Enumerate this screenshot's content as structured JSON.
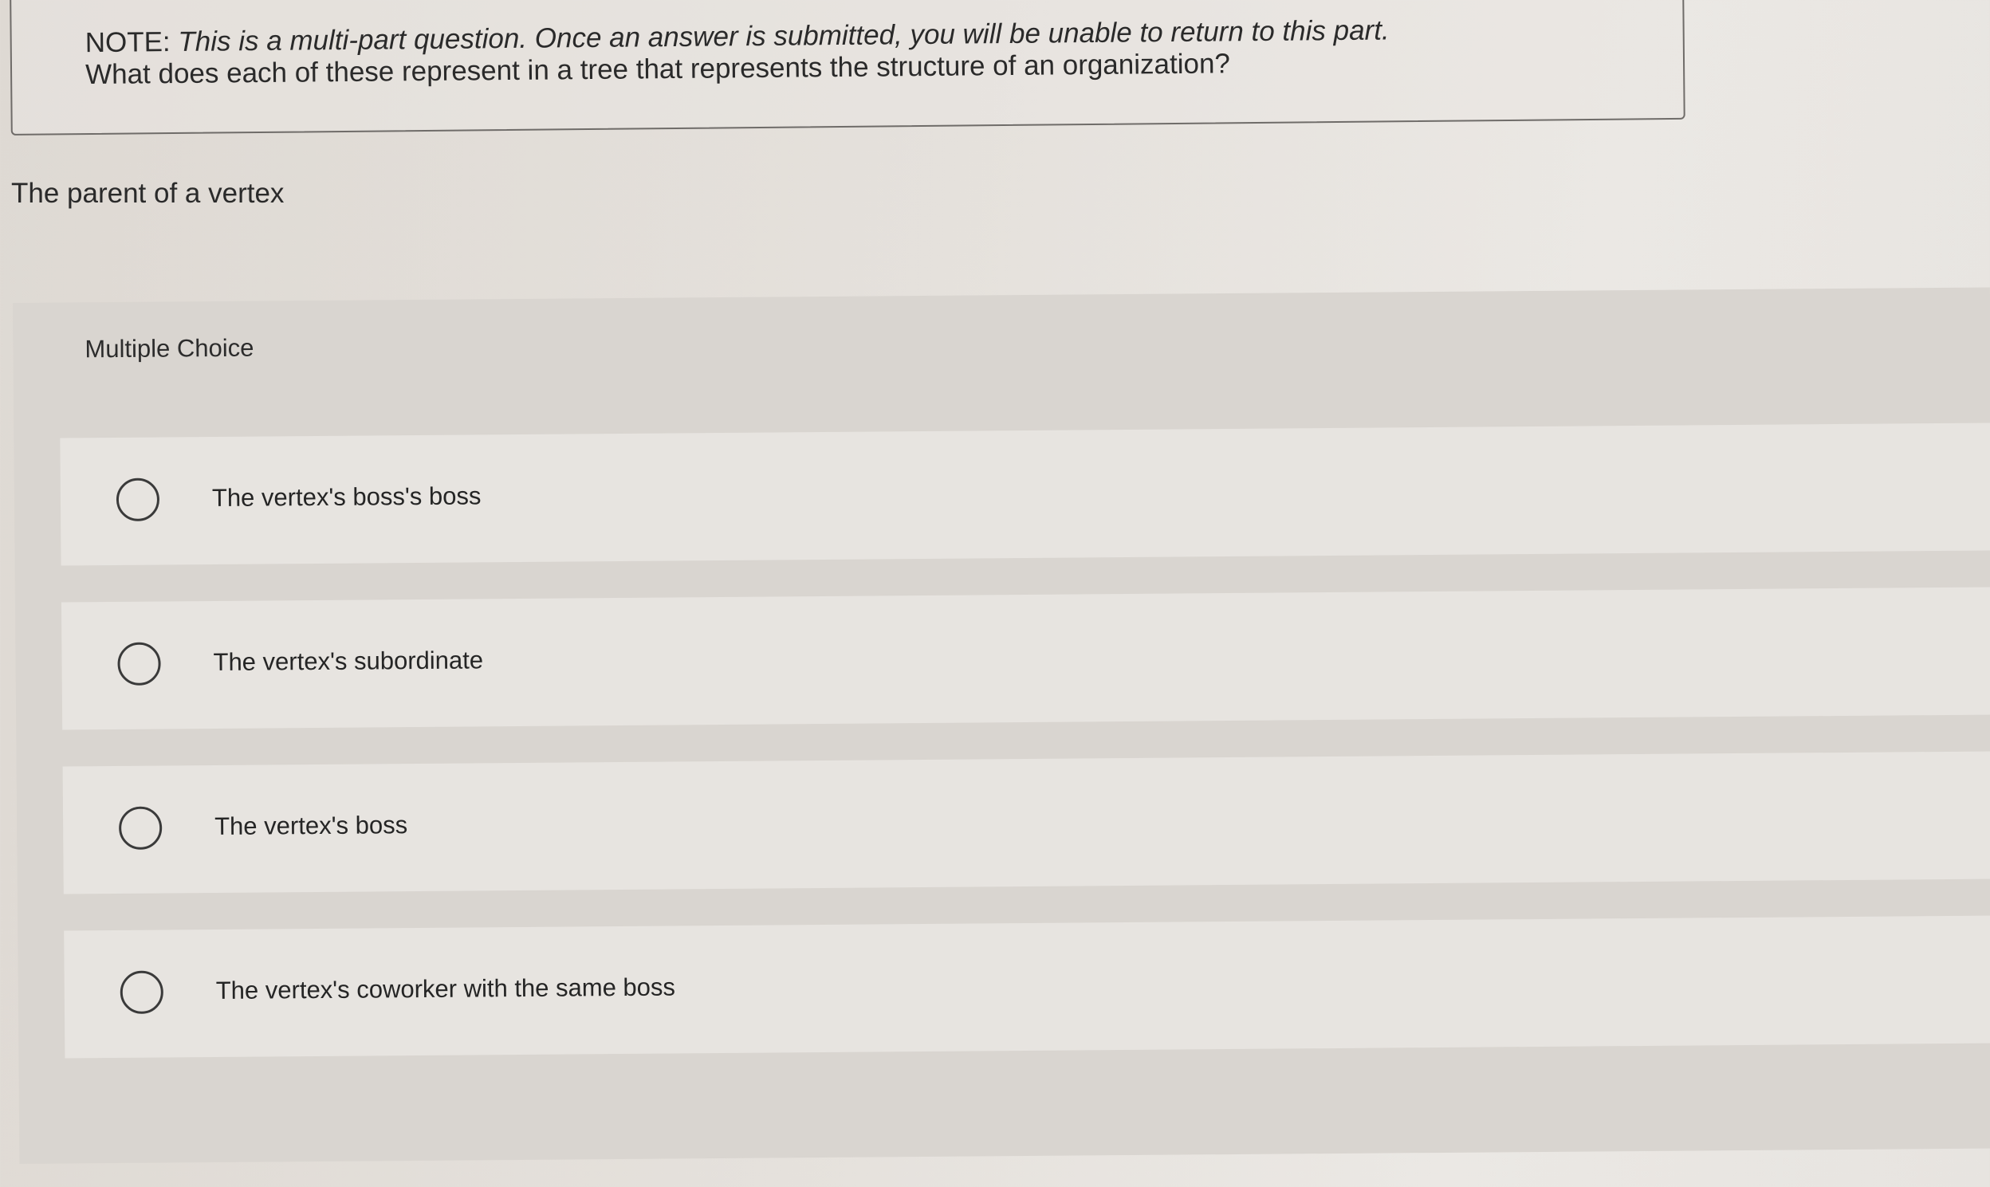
{
  "note": {
    "prefix": "NOTE: ",
    "italic_text": "This is a multi-part question. Once an answer is submitted, you will be unable to return to this part.",
    "question": "What does each of these represent in a tree that represents the structure of an organization?"
  },
  "prompt": "The parent of a vertex",
  "multiple_choice": {
    "label": "Multiple Choice",
    "options": [
      {
        "label": "The vertex's boss's boss"
      },
      {
        "label": "The vertex's subordinate"
      },
      {
        "label": "The vertex's boss"
      },
      {
        "label": "The vertex's coworker with the same boss"
      }
    ]
  }
}
